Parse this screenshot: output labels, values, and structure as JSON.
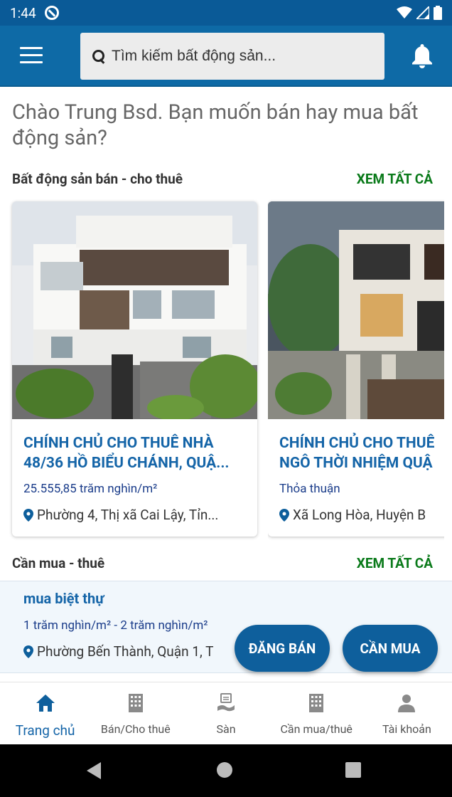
{
  "status": {
    "time": "1:44"
  },
  "search": {
    "placeholder": "Tìm kiếm bất động sản..."
  },
  "greeting": "Chào Trung Bsd. Bạn muốn bán hay mua bất động sản?",
  "sale_section": {
    "title": "Bất động sản bán - cho thuê",
    "link": "XEM TẤT CẢ"
  },
  "cards": [
    {
      "title_line1": "CHÍNH CHỦ CHO THUÊ NHÀ",
      "title_line2": "48/36 HỒ BIỂU CHÁNH, QUẬ...",
      "price": "25.555,85 trăm nghìn/m²",
      "location": "Phường 4, Thị xã Cai Lậy, Tỉn..."
    },
    {
      "title_line1": "CHÍNH CHỦ CHO THUÊ",
      "title_line2": "NGÔ THỜI NHIỆM QUẬ",
      "price": "Thỏa thuận",
      "location": "Xã Long Hòa, Huyện B"
    }
  ],
  "wanted_section": {
    "title": "Cần mua - thuê",
    "link": "XEM TẤT CẢ"
  },
  "wanted_items": [
    {
      "title": "mua biệt thự",
      "price": "1 trăm nghìn/m² - 2 trăm nghìn/m²",
      "location": "Phường Bến Thành, Quận 1, T"
    }
  ],
  "fabs": {
    "sell": "ĐĂNG BÁN",
    "buy": "CẦN MUA"
  },
  "bottom_nav": [
    {
      "label": "Trang chủ",
      "icon": "home-icon",
      "active": true
    },
    {
      "label": "Bán/Cho thuê",
      "icon": "building-icon"
    },
    {
      "label": "Sàn",
      "icon": "exchange-icon"
    },
    {
      "label": "Cần mua/thuê",
      "icon": "building-icon"
    },
    {
      "label": "Tài khoản",
      "icon": "person-icon"
    }
  ],
  "colors": {
    "primary": "#0e6aa6",
    "link_green": "#0a7a1a",
    "title_blue": "#1565a8"
  }
}
